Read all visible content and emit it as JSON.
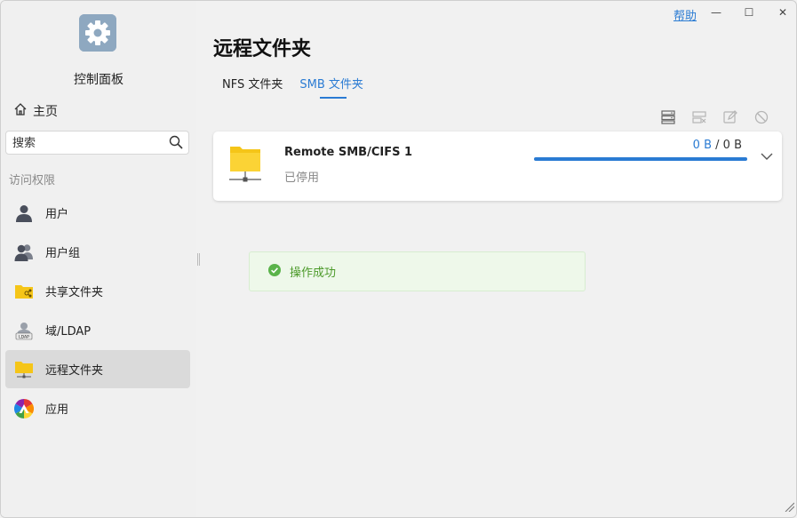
{
  "app": {
    "title": "控制面板",
    "icon": "gear-icon"
  },
  "window": {
    "help_label": "帮助",
    "minimize_label": "—",
    "maximize_label": "☐",
    "close_label": "✕"
  },
  "sidebar": {
    "home_label": "主页",
    "search_placeholder": "搜索",
    "section_label": "访问权限",
    "items": [
      {
        "label": "用户",
        "icon": "user-icon",
        "active": false
      },
      {
        "label": "用户组",
        "icon": "users-icon",
        "active": false
      },
      {
        "label": "共享文件夹",
        "icon": "shared-folder-icon",
        "active": false
      },
      {
        "label": "域/LDAP",
        "icon": "ldap-icon",
        "active": false
      },
      {
        "label": "远程文件夹",
        "icon": "remote-folder-icon",
        "active": true
      },
      {
        "label": "应用",
        "icon": "app-icon",
        "active": false
      }
    ]
  },
  "main": {
    "title": "远程文件夹",
    "tabs": [
      {
        "label": "NFS 文件夹",
        "active": false
      },
      {
        "label": "SMB 文件夹",
        "active": true
      }
    ],
    "toolbar": [
      "server-list-icon",
      "unmount-icon",
      "edit-icon",
      "disable-icon"
    ],
    "folder": {
      "name": "Remote SMB/CIFS 1",
      "status": "已停用",
      "used": "0 B",
      "separator": "/",
      "total": "0 B",
      "progress": 1.0
    },
    "toast": {
      "message": "操作成功",
      "icon": "check-circle-icon"
    }
  },
  "colors": {
    "accent": "#2a7bd3",
    "success": "#5ab34a",
    "folder": "#f5c518"
  }
}
